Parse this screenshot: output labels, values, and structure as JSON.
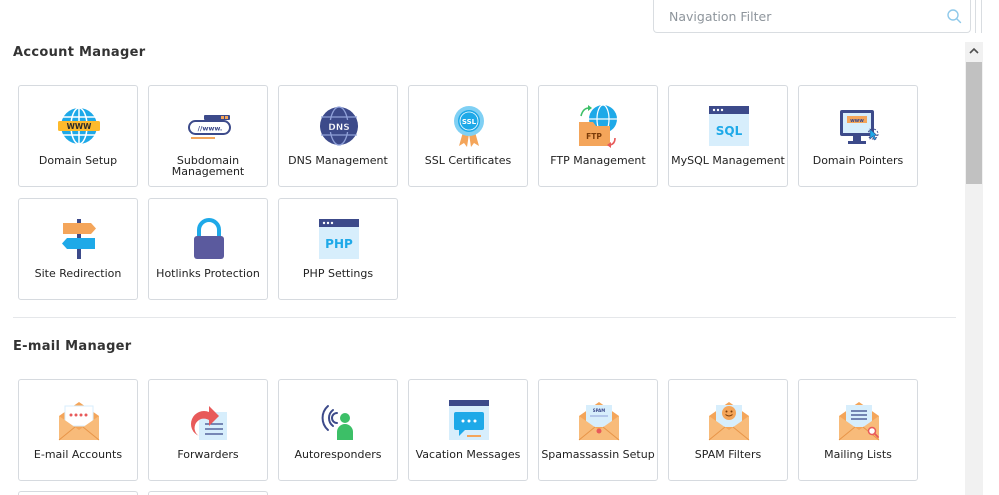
{
  "filter": {
    "placeholder": "Navigation Filter"
  },
  "sections": [
    {
      "title": "Account Manager"
    },
    {
      "title": "E-mail Manager"
    }
  ],
  "account_tiles": [
    {
      "label": "Domain Setup",
      "icon": "globe-www-icon"
    },
    {
      "label": "Subdomain Management",
      "icon": "subdomain-www-bar-icon"
    },
    {
      "label": "DNS Management",
      "icon": "dns-globe-icon"
    },
    {
      "label": "SSL Certificates",
      "icon": "ssl-badge-icon"
    },
    {
      "label": "FTP Management",
      "icon": "ftp-folder-globe-icon"
    },
    {
      "label": "MySQL Management",
      "icon": "sql-window-icon"
    },
    {
      "label": "Domain Pointers",
      "icon": "monitor-www-pointer-icon"
    },
    {
      "label": "Site Redirection",
      "icon": "signpost-icon"
    },
    {
      "label": "Hotlinks Protection",
      "icon": "padlock-icon"
    },
    {
      "label": "PHP Settings",
      "icon": "php-window-icon"
    }
  ],
  "email_tiles": [
    {
      "label": "E-mail Accounts",
      "icon": "envelope-password-icon"
    },
    {
      "label": "Forwarders",
      "icon": "forward-arrow-document-icon"
    },
    {
      "label": "Autoresponders",
      "icon": "person-broadcast-icon"
    },
    {
      "label": "Vacation Messages",
      "icon": "calendar-message-icon"
    },
    {
      "label": "Spamassassin Setup",
      "icon": "envelope-spam-icon"
    },
    {
      "label": "SPAM Filters",
      "icon": "envelope-smiley-icon"
    },
    {
      "label": "Mailing Lists",
      "icon": "envelope-list-search-icon"
    }
  ],
  "colors": {
    "tile_border": "#d6dadf",
    "globe_blue": "#1ea9e8",
    "orange": "#f4a55a",
    "navy": "#3c4a8a",
    "purple": "#5b5a9e",
    "green": "#3cbf67",
    "red": "#e85a5a"
  }
}
